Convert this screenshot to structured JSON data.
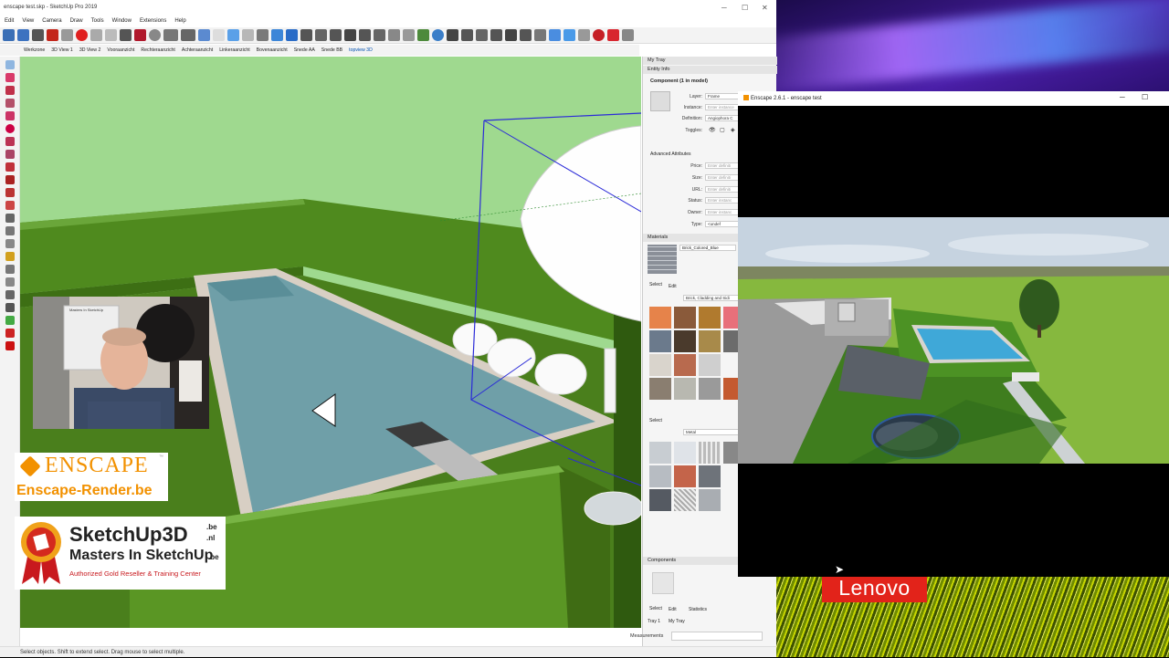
{
  "sketchup": {
    "title": "enscape test.skp - SketchUp Pro 2019",
    "menu": [
      "Edit",
      "View",
      "Camera",
      "Draw",
      "Tools",
      "Window",
      "Extensions",
      "Help"
    ],
    "scenes": [
      "Werkzone",
      "3D View 1",
      "3D View 2",
      "Vooraanzicht",
      "Rechteraanzicht",
      "Achteraanzicht",
      "Linkeraanzicht",
      "Bovenaanzicht",
      "Snede AA",
      "Snede BB",
      "topview 3D"
    ],
    "status": "Select objects. Shift to extend select. Drag mouse to select multiple."
  },
  "tray": {
    "title": "My Tray",
    "entity_info": {
      "header": "Entity Info",
      "component": "Component (1 in model)",
      "layer_label": "Layer:",
      "layer_value": "Frame",
      "instance_label": "Instance:",
      "instance_placeholder": "Enter instance",
      "definition_label": "Definition:",
      "definition_value": "Angiophora C",
      "toggles_label": "Toggles:",
      "advanced": "Advanced Attributes",
      "price_label": "Price:",
      "size_label": "Size:",
      "url_label": "URL:",
      "status_label": "Status:",
      "owner_label": "Owner:",
      "type_label": "Type:",
      "price_placeholder": "Enter definiti",
      "size_placeholder": "Enter definiti",
      "url_placeholder": "Enter definiti",
      "status_placeholder": "Enter instanc",
      "owner_placeholder": "Enter instanc",
      "type_value": "<undef"
    },
    "materials": {
      "header": "Materials",
      "current": "Brick_Colored_Blue",
      "select_tab": "Select",
      "edit_tab": "Edit",
      "library": "Brick, Cladding and Sidi",
      "select_tab2": "Select",
      "library2": "Metal"
    },
    "components": {
      "header": "Components",
      "select_tab": "Select",
      "edit_tab": "Edit",
      "stats_tab": "Statistics"
    },
    "bottom_tabs": [
      "Tray 1",
      "My Tray"
    ],
    "measurements": "Measurements"
  },
  "enscape": {
    "title": "Enscape 2.6.1 - enscape test"
  },
  "overlays": {
    "enscape_logo": "ENSCAPE",
    "enscape_tm": "™",
    "enscape_url": "Enscape-Render.be",
    "su3d_title": "SketchUp3D",
    "su3d_be": ".be",
    "su3d_nl": ".nl",
    "su3d_masters": "Masters In SketchUp",
    "su3d_masters_be": ".be",
    "su3d_tag": "Authorized Gold Reseller & Training Center",
    "webcam_sign": "Masters In SketchUp"
  },
  "desktop": {
    "lenovo": "Lenovo"
  },
  "colors": {
    "hedge": "#4f8a1e",
    "pool_water": "#6f9fa8",
    "coping": "#d8cfc4",
    "enscape_orange": "#f29100",
    "su_red": "#d42a1e"
  }
}
